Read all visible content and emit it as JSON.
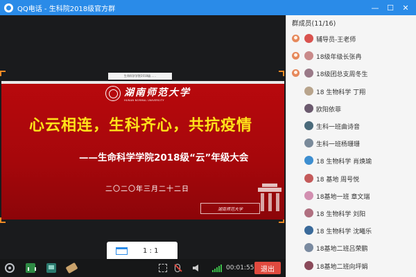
{
  "window": {
    "title": "QQ电话 - 生科院2018级官方群",
    "controls": [
      "minimize",
      "maximize",
      "close"
    ],
    "minimize_glyph": "—",
    "maximize_glyph": "☐",
    "close_glyph": "✕"
  },
  "slide": {
    "top_strip": "生命科学学院2018级……",
    "university_cn": "湖南师范大学",
    "university_en": "HUNAN NORMAL UNIVERSITY",
    "headline": "心云相连，生科齐心，共抗疫情",
    "subheadline": "——生命科学学院2018级“云”年级大会",
    "date": "二〇二〇年三月二十二日",
    "stamp": "湖南师范大学"
  },
  "zoom": {
    "ratio": "1 : 1"
  },
  "controls": {
    "icons": [
      "settings-icon",
      "poll-icon",
      "share-screen-icon",
      "whiteboard-icon",
      "fullscreen-icon",
      "mic-muted-icon",
      "speaker-icon",
      "signal-icon"
    ],
    "timer": "00:01:55",
    "exit_label": "退出"
  },
  "members": {
    "header": "群成员(11/16)",
    "items": [
      {
        "name": "辅导员-王老师",
        "role": true,
        "avatar_color": "#d9534f"
      },
      {
        "name": "18级年级长张冉",
        "role": true,
        "avatar_color": "#c98a8a"
      },
      {
        "name": "18级团总支周冬生",
        "role": true,
        "avatar_color": "#9a7a88"
      },
      {
        "name": "18 生物科学 丁翔",
        "role": false,
        "avatar_color": "#b8a48c"
      },
      {
        "name": "欧阳依菲",
        "role": false,
        "avatar_color": "#6b5a6e"
      },
      {
        "name": "生科一班曲诗音",
        "role": false,
        "avatar_color": "#4a6a7a"
      },
      {
        "name": "生科一班杨珊珊",
        "role": false,
        "avatar_color": "#7a8a9a"
      },
      {
        "name": "18 生物科学  肖焕瑜",
        "role": false,
        "avatar_color": "#3d8ed0"
      },
      {
        "name": "18 基地 周号悦",
        "role": false,
        "avatar_color": "#c45a5a"
      },
      {
        "name": "18基地一班 章文瑞",
        "role": false,
        "avatar_color": "#d28fb0"
      },
      {
        "name": "18 生物科学 刘阳",
        "role": false,
        "avatar_color": "#b07080"
      },
      {
        "name": "18 生物科学 沈曦乐",
        "role": false,
        "avatar_color": "#3a6a9a"
      },
      {
        "name": "18基地二班吕荣鹏",
        "role": false,
        "avatar_color": "#7a8aa0"
      },
      {
        "name": "18基地二班向坪娟",
        "role": false,
        "avatar_color": "#8a4a5a"
      }
    ]
  }
}
